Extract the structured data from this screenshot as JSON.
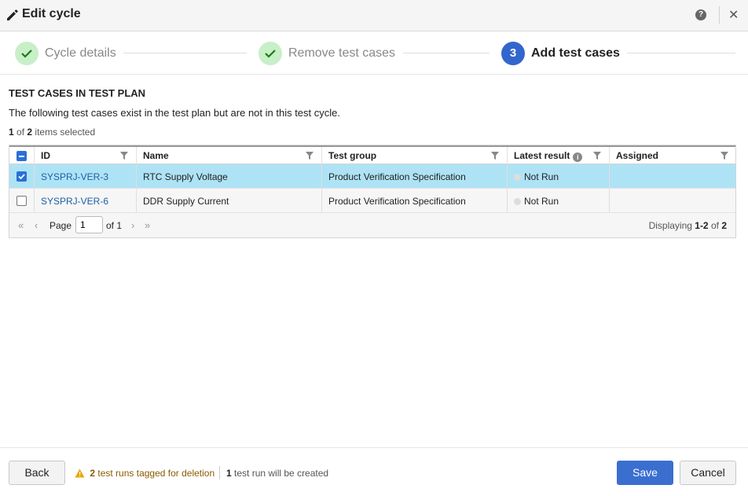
{
  "header": {
    "title": "Edit cycle",
    "help_label": "?",
    "close_label": "✕"
  },
  "stepper": {
    "steps": [
      {
        "label": "Cycle details",
        "state": "done"
      },
      {
        "label": "Remove test cases",
        "state": "done"
      },
      {
        "number": "3",
        "label": "Add test cases",
        "state": "active"
      }
    ]
  },
  "section": {
    "title": "TEST CASES IN TEST PLAN",
    "description": "The following test cases exist in the test plan but are not in this test cycle.",
    "selected_count": "1",
    "selected_of": "of",
    "selected_total": "2",
    "selected_suffix": "items selected"
  },
  "grid": {
    "columns": [
      {
        "label": "ID"
      },
      {
        "label": "Name"
      },
      {
        "label": "Test group"
      },
      {
        "label": "Latest result"
      },
      {
        "label": "Assigned"
      }
    ],
    "rows": [
      {
        "selected": true,
        "id": "SYSPRJ-VER-3",
        "name": "RTC Supply Voltage",
        "test_group": "Product Verification Specification",
        "latest_result": "Not Run",
        "assigned": ""
      },
      {
        "selected": false,
        "id": "SYSPRJ-VER-6",
        "name": "DDR Supply Current",
        "test_group": "Product Verification Specification",
        "latest_result": "Not Run",
        "assigned": ""
      }
    ]
  },
  "pager": {
    "page_label": "Page",
    "page_value": "1",
    "of_label": "of 1",
    "display_prefix": "Displaying",
    "display_range": "1-2",
    "display_of": "of",
    "display_total": "2"
  },
  "footer": {
    "back_label": "Back",
    "warn_count": "2",
    "warn_text": "test runs tagged for deletion",
    "info_count": "1",
    "info_text": "test run will be created",
    "save_label": "Save",
    "cancel_label": "Cancel"
  },
  "colors": {
    "accent": "#3a6fd0",
    "selected_row": "#aee3f5",
    "step_done": "#c8efc8",
    "warning": "#e6a700"
  }
}
